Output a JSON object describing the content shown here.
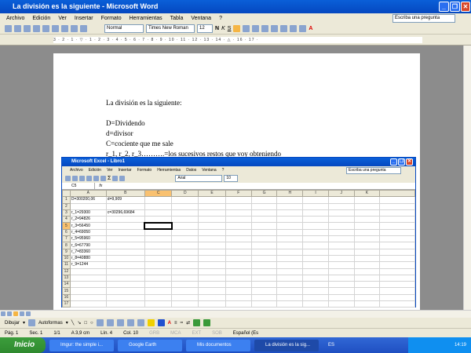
{
  "word": {
    "title": "La división es la siguiente - Microsoft Word",
    "menu": [
      "Archivo",
      "Edición",
      "Ver",
      "Insertar",
      "Formato",
      "Herramientas",
      "Tabla",
      "Ventana",
      "?"
    ],
    "help_placeholder": "Escriba una pregunta",
    "style": "Normal",
    "font": "Times New Roman",
    "size": "12",
    "bold": "N",
    "italic": "K",
    "underline": "S",
    "ruler": "3 · 2 · 1 · ▽ · 1 · 2 · 3 · 4 · 5 · 6 · 7 · 8 · 9 · 10 · 11 · 12 · 13 · 14 · △ · 16 · 17 ·",
    "lines": [
      "La división es la siguiente:",
      "",
      "D=Dividendo",
      "d=divisor",
      "C=cociente que me sale",
      "r_1, r_2, r_3……….=los sucesivos restos que voy obteniendo"
    ],
    "draw_label": "Dibujar",
    "autoshapes": "Autoformas",
    "status": [
      "Pág. 1",
      "Sec. 1",
      "1/1",
      "A 3,9 cm",
      "Lín. 4",
      "Col. 10",
      "GRB",
      "MCA",
      "EXT",
      "SOB",
      "Español (Es"
    ]
  },
  "excel": {
    "title": "Microsoft Excel - Libro1",
    "menu": [
      "Archivo",
      "Edición",
      "Ver",
      "Insertar",
      "Formato",
      "Herramientas",
      "Datos",
      "Ventana",
      "?"
    ],
    "help_placeholder": "Escriba una pregunta",
    "font": "Arial",
    "size": "10",
    "name_box": "C5",
    "fx": "fx",
    "columns": [
      "A",
      "B",
      "C",
      "D",
      "E",
      "F",
      "G",
      "H",
      "I",
      "J",
      "K"
    ],
    "rows": [
      [
        "D=300200,06",
        "d=9,909"
      ],
      [],
      [
        "r_1=29300",
        "c=30296,69684"
      ],
      [
        "r_2=94826"
      ],
      [
        "r_3=56450"
      ],
      [
        "r_4=69050"
      ],
      [
        "r_5=95960"
      ],
      [
        "r_6=67790"
      ],
      [
        "r_7=83360"
      ],
      [
        "r_8=40880"
      ],
      [
        "r_9=1244"
      ],
      [],
      [],
      [],
      [],
      [],
      [],
      []
    ]
  },
  "taskbar": {
    "start": "Inicio",
    "tasks": [
      "Imgur: the simple i...",
      "Google Earth",
      "Mis documentos",
      "La división es la sig..."
    ],
    "lang": "ES",
    "clock": "14:19"
  }
}
